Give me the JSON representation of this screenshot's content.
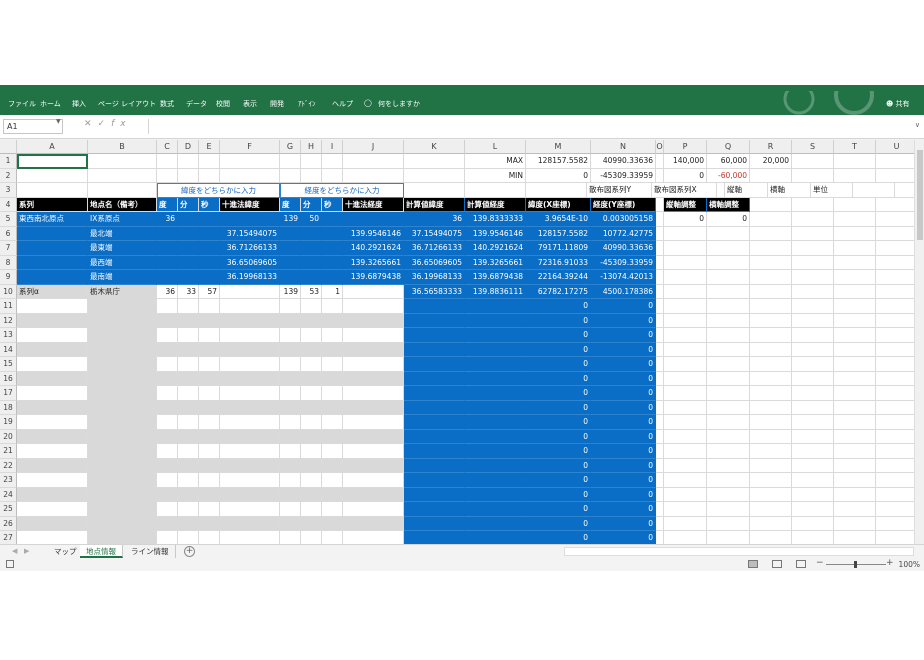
{
  "ribbon": {
    "tabs": [
      "ファイル",
      "ホーム",
      "挿入",
      "ページ レイアウト",
      "数式",
      "データ",
      "校閲",
      "表示",
      "開発",
      "ｱﾄﾞｲﾝ",
      "ヘルプ"
    ],
    "tellme": "何をしますか",
    "share": "共有"
  },
  "formula_bar": {
    "name_box": "A1",
    "fx": "fx",
    "value": ""
  },
  "columns": [
    "A",
    "B",
    "C",
    "D",
    "E",
    "F",
    "G",
    "H",
    "I",
    "J",
    "K",
    "L",
    "M",
    "N",
    "O",
    "P",
    "Q",
    "R",
    "S",
    "T",
    "U"
  ],
  "rows": {
    "r1": {
      "num": "1",
      "L": "MAX",
      "M": "128157.5582",
      "N": "40990.33636",
      "P": "140,000",
      "Q": "60,000",
      "R": "20,000"
    },
    "r2": {
      "num": "2",
      "L": "MIN",
      "M": "0",
      "N": "-45309.33959",
      "P": "0",
      "Q": "-60,000"
    },
    "r3": {
      "num": "3",
      "C": "緯度をどちらかに入力",
      "G": "経度をどちらかに入力",
      "M": "散布図系列Y",
      "N": "散布図系列X",
      "P": "縦軸",
      "Q": "横軸",
      "R": "単位"
    },
    "r4": {
      "num": "4",
      "A": "系列",
      "B": "地点名（備考）",
      "C": "度",
      "D": "分",
      "E": "秒",
      "F": "十進法緯度",
      "G": "度",
      "H": "分",
      "I": "秒",
      "J": "十進法経度",
      "K": "計算値緯度",
      "L": "計算値経度",
      "M": "緯度(X座標)",
      "N": "経度(Y座標)",
      "P": "縦軸調整",
      "Q": "横軸調整"
    },
    "r5": {
      "num": "5",
      "A": "東西南北原点",
      "B": "IX系原点",
      "C": "36",
      "G": "139",
      "H": "50",
      "K": "36",
      "L": "139.8333333",
      "M": "3.9654E-10",
      "N": "0.003005158",
      "P": "0",
      "Q": "0"
    },
    "r6": {
      "num": "6",
      "B": "最北端",
      "F": "37.15494075",
      "J": "139.9546146",
      "K": "37.15494075",
      "L": "139.9546146",
      "M": "128157.5582",
      "N": "10772.42775"
    },
    "r7": {
      "num": "7",
      "B": "最東端",
      "F": "36.71266133",
      "J": "140.2921624",
      "K": "36.71266133",
      "L": "140.2921624",
      "M": "79171.11809",
      "N": "40990.33636"
    },
    "r8": {
      "num": "8",
      "B": "最西端",
      "F": "36.65069605",
      "J": "139.3265661",
      "K": "36.65069605",
      "L": "139.3265661",
      "M": "72316.91033",
      "N": "-45309.33959"
    },
    "r9": {
      "num": "9",
      "B": "最南端",
      "F": "36.19968133",
      "J": "139.6879438",
      "K": "36.19968133",
      "L": "139.6879438",
      "M": "22164.39244",
      "N": "-13074.42013"
    },
    "r10": {
      "num": "10",
      "A": "系列α",
      "B": "栃木県庁",
      "C": "36",
      "D": "33",
      "E": "57",
      "G": "139",
      "H": "53",
      "I": "1",
      "K": "36.56583333",
      "L": "139.8836111",
      "M": "62782.17275",
      "N": "4500.178386"
    }
  },
  "empty_rows": [
    "11",
    "12",
    "13",
    "14",
    "15",
    "16",
    "17",
    "18",
    "19",
    "20",
    "21",
    "22",
    "23",
    "24",
    "25",
    "26",
    "27"
  ],
  "zero": "0",
  "sheets": [
    "マップ",
    "地点情報",
    "ライン情報"
  ],
  "active_sheet": "地点情報",
  "zoom": "100%",
  "colors": {
    "excel_green": "#217346",
    "cell_blue": "#0a6ec6"
  }
}
